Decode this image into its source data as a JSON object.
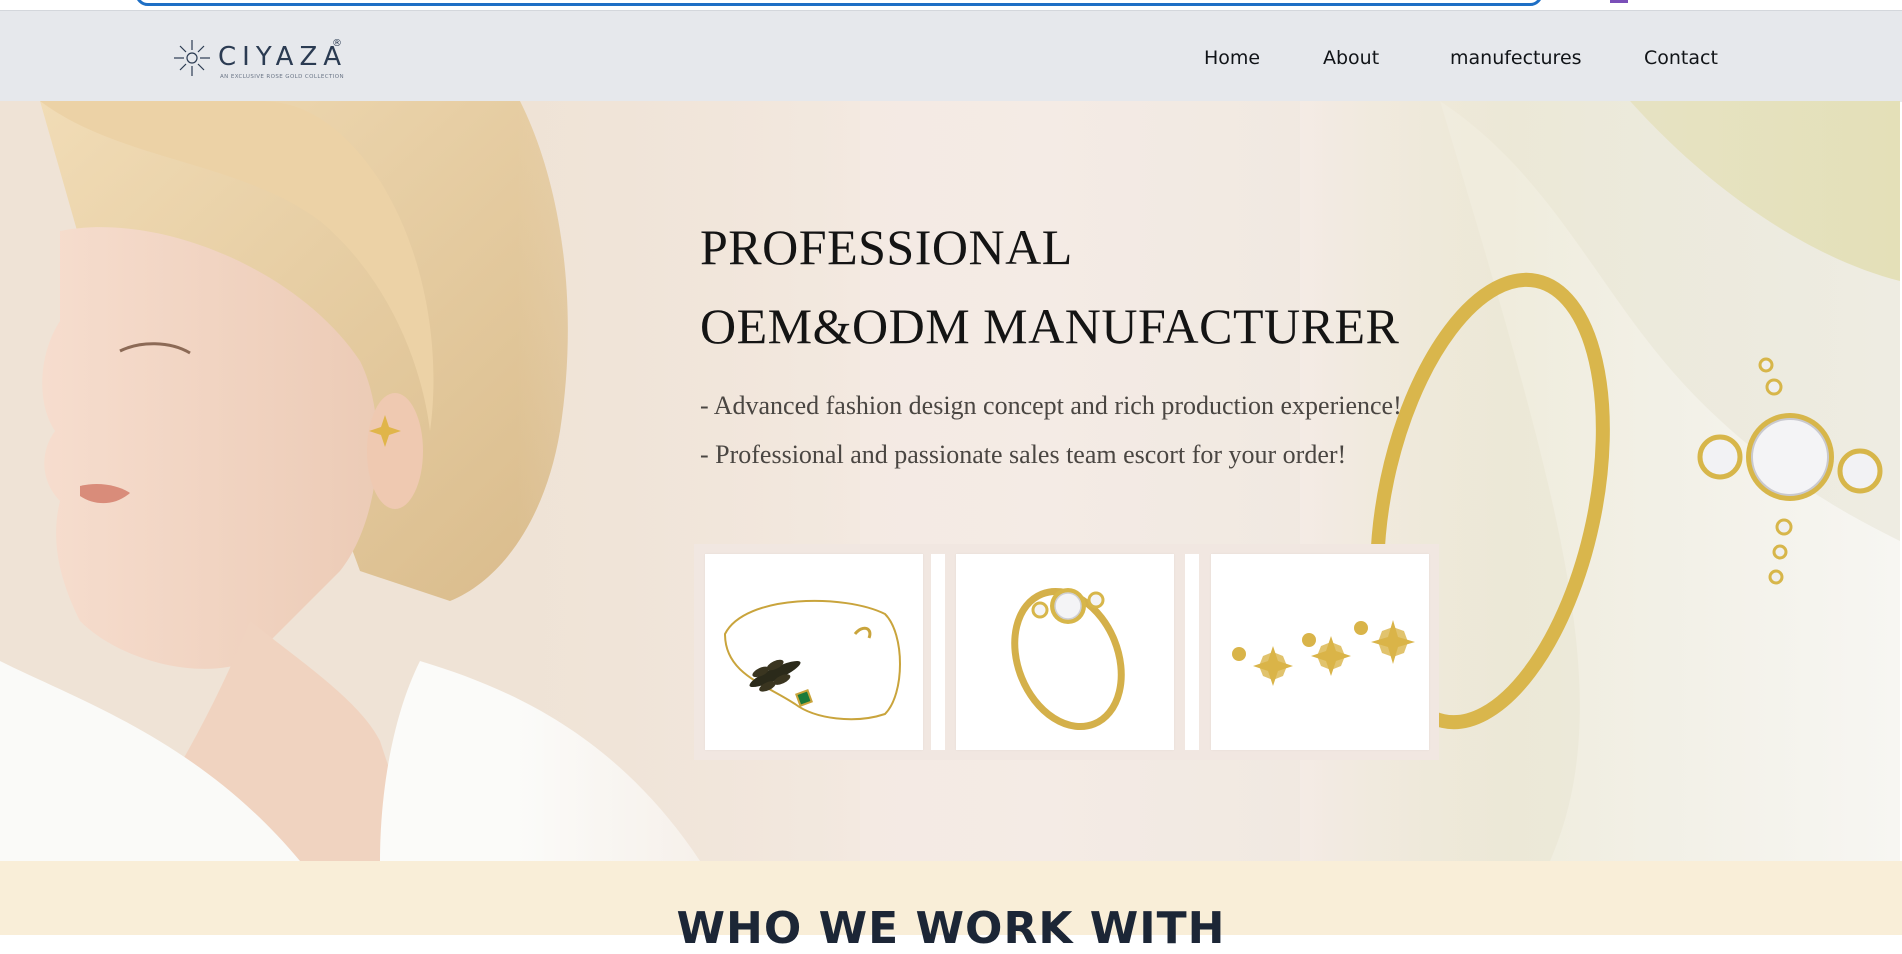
{
  "header": {
    "logo": {
      "name": "CIYAZA",
      "registered": "®",
      "tagline": "AN EXCLUSIVE ROSE GOLD COLLECTION"
    },
    "nav": [
      {
        "label": "Home"
      },
      {
        "label": "About"
      },
      {
        "label": "manufectures"
      },
      {
        "label": "Contact"
      }
    ]
  },
  "hero": {
    "title_line1": "PROFESSIONAL",
    "title_line2": "OEM&ODM MANUFACTURER",
    "bullet1": "- Advanced fashion design concept and rich production experience!",
    "bullet2": "- Professional  and passionate sales team escort for your order!",
    "products": [
      {
        "icon": "bracelet-icon"
      },
      {
        "icon": "ring-icon"
      },
      {
        "icon": "star-earrings-icon"
      }
    ]
  },
  "section": {
    "title": "WHO WE WORK WITH"
  },
  "colors": {
    "header_bg": "#e6e8ec",
    "nav_text": "#111418",
    "hero_text": "#141414",
    "gold": "#d7b64a",
    "section_bg": "#f9eed8",
    "section_title": "#1c2636",
    "search_border": "#1e6fc5"
  }
}
